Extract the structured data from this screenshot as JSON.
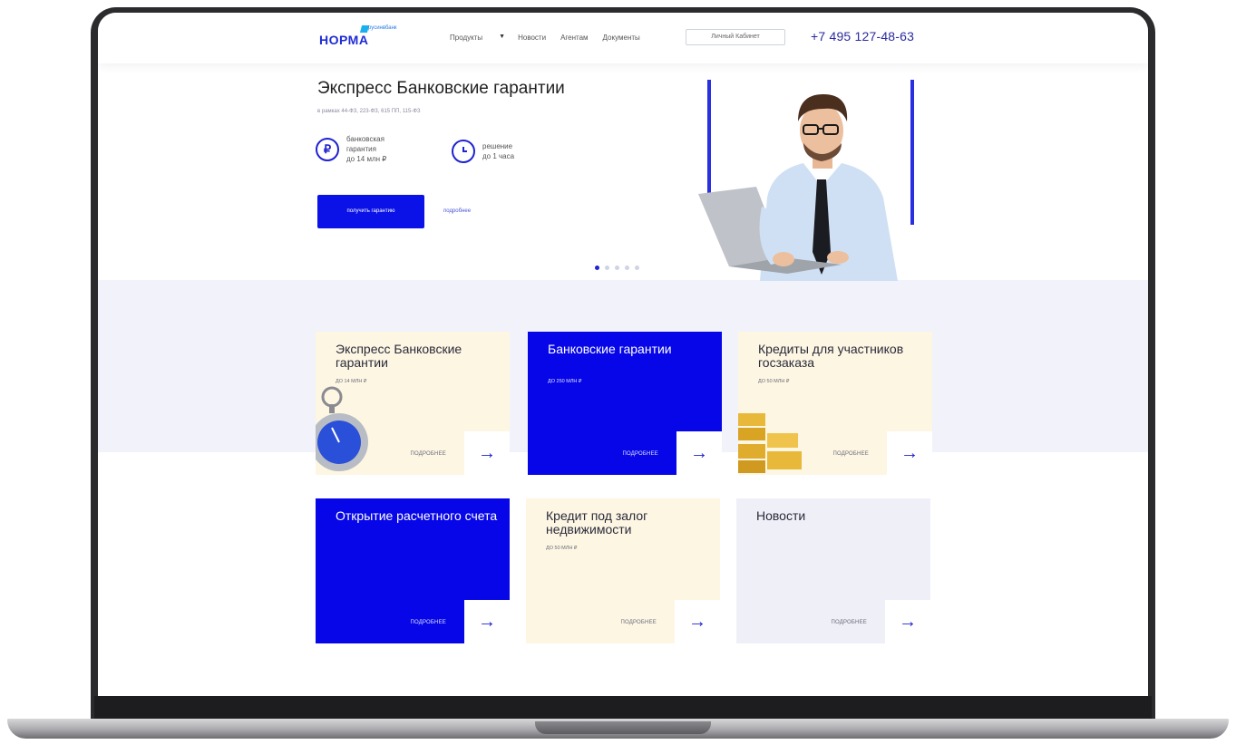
{
  "header": {
    "logo": "НОРМА",
    "logo_sub": "русинвбанк",
    "nav": [
      {
        "label": "Продукты"
      },
      {
        "label": "Новости"
      },
      {
        "label": "Агентам"
      },
      {
        "label": "Документы"
      }
    ],
    "cabinet_label": "Личный Кабинет",
    "phone": "+7 495 127-48-63"
  },
  "hero": {
    "title": "Экспресс Банковские гарантии",
    "subtitle": "в рамках 44-ФЗ, 223-ФЗ, 615 ПП, 115-ФЗ",
    "feature1": {
      "icon": "ruble-icon",
      "icon_glyph": "₽",
      "line1": "банковская",
      "line2": "гарантия",
      "line3": "до 14 млн ₽"
    },
    "feature2": {
      "icon": "clock-icon",
      "line1": "решение",
      "line2": "до 1 часа"
    },
    "cta_label": "получить гарантию",
    "more_label": "подробнее",
    "slides": 5,
    "active_slide": 1
  },
  "cards": [
    {
      "title": "Экспресс Банковские гарантии",
      "amount": "ДО 14 МЛН ₽",
      "more": "ПОДРОБНЕЕ",
      "arrow": "→",
      "style": "cream",
      "image": "stopwatch-icon"
    },
    {
      "title": "Банковские гарантии",
      "amount": "ДО 250 МЛН ₽",
      "more": "ПОДРОБНЕЕ",
      "arrow": "→",
      "style": "blue"
    },
    {
      "title": "Кредиты для участников госзаказа",
      "amount": "ДО 50 МЛН ₽",
      "more": "ПОДРОБНЕЕ",
      "arrow": "→",
      "style": "cream",
      "image": "gold-bars-icon"
    },
    {
      "title": "Открытие расчетного счета",
      "amount": "",
      "more": "ПОДРОБНЕЕ",
      "arrow": "→",
      "style": "blue"
    },
    {
      "title": "Кредит под залог недвижимости",
      "amount": "ДО 50 МЛН ₽",
      "more": "ПОДРОБНЕЕ",
      "arrow": "→",
      "style": "cream"
    },
    {
      "title": "Новости",
      "amount": "",
      "more": "ПОДРОБНЕЕ",
      "arrow": "→",
      "style": "lavender"
    }
  ],
  "colors": {
    "accent": "#0606e8",
    "cream": "#fdf6e3",
    "band": "#f1f2fa",
    "lavender": "#efeff8"
  }
}
